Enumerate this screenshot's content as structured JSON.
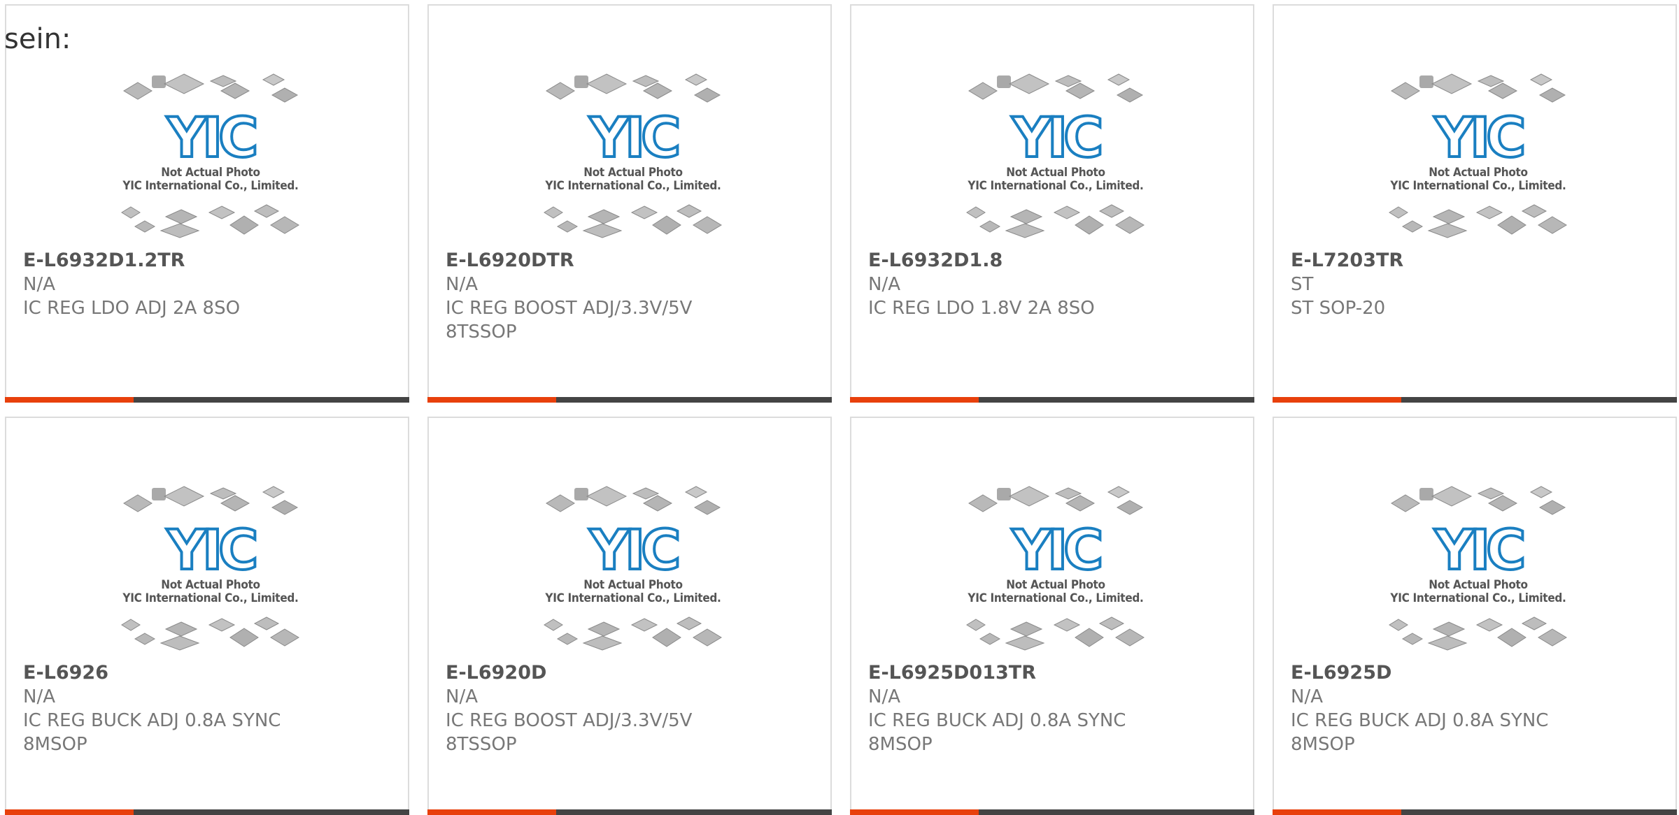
{
  "lead_text": "sein:",
  "thumb": {
    "caption_line1": "Not Actual Photo",
    "caption_line2": "YIC International Co., Limited.",
    "logo_text": "YIC",
    "logo_color": "#1a7fc1"
  },
  "accent_color": "#e8400c",
  "bar_color": "#444444",
  "products": [
    {
      "part_number": "E-L6932D1.2TR",
      "manufacturer": "N/A",
      "desc1": "IC REG LDO ADJ 2A 8SO",
      "desc2": ""
    },
    {
      "part_number": "E-L6920DTR",
      "manufacturer": "N/A",
      "desc1": "IC REG BOOST ADJ/3.3V/5V",
      "desc2": "8TSSOP"
    },
    {
      "part_number": "E-L6932D1.8",
      "manufacturer": "N/A",
      "desc1": "IC REG LDO 1.8V 2A 8SO",
      "desc2": ""
    },
    {
      "part_number": "E-L7203TR",
      "manufacturer": "ST",
      "desc1": "ST SOP-20",
      "desc2": ""
    },
    {
      "part_number": "E-L6926",
      "manufacturer": "N/A",
      "desc1": "IC REG BUCK ADJ 0.8A SYNC",
      "desc2": "8MSOP"
    },
    {
      "part_number": "E-L6920D",
      "manufacturer": "N/A",
      "desc1": "IC REG BOOST ADJ/3.3V/5V",
      "desc2": "8TSSOP"
    },
    {
      "part_number": "E-L6925D013TR",
      "manufacturer": "N/A",
      "desc1": "IC REG BUCK ADJ 0.8A SYNC",
      "desc2": "8MSOP"
    },
    {
      "part_number": "E-L6925D",
      "manufacturer": "N/A",
      "desc1": "IC REG BUCK ADJ 0.8A SYNC",
      "desc2": "8MSOP"
    }
  ]
}
